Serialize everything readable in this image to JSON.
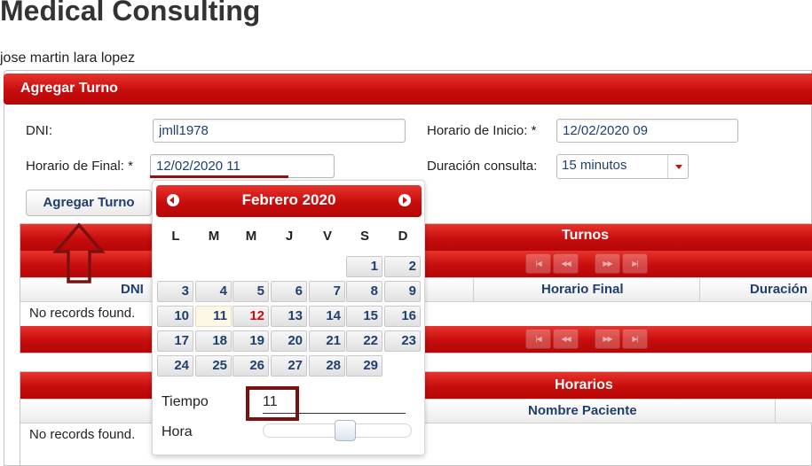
{
  "page": {
    "title": "Medical Consulting",
    "user": "jose martin lara lopez"
  },
  "panel": {
    "title": "Agregar Turno"
  },
  "form": {
    "dni": {
      "label": "DNI:",
      "value": "jmll1978"
    },
    "horario_inicio": {
      "label": "Horario de Inicio:",
      "required": "*",
      "value": "12/02/2020 09"
    },
    "horario_final": {
      "label": "Horario de Final:",
      "required": "*",
      "value": "12/02/2020 11"
    },
    "duracion": {
      "label": "Duración consulta:",
      "value": "15 minutos"
    },
    "submit_label": "Agregar Turno"
  },
  "turnos_table": {
    "title": "Turnos",
    "columns": [
      "DNI",
      "Horario Final",
      "Duración"
    ],
    "empty_message": "No records found."
  },
  "horarios_table": {
    "title": "Horarios",
    "columns": [
      "Nombre Paciente"
    ],
    "empty_message": "No records found."
  },
  "calendar": {
    "month_label": "Febrero 2020",
    "weekdays": [
      "L",
      "M",
      "M",
      "J",
      "V",
      "S",
      "D"
    ],
    "weeks": [
      [
        "",
        "",
        "",
        "",
        "",
        "1",
        "2"
      ],
      [
        "3",
        "4",
        "5",
        "6",
        "7",
        "8",
        "9"
      ],
      [
        "10",
        "11",
        "12",
        "13",
        "14",
        "15",
        "16"
      ],
      [
        "17",
        "18",
        "19",
        "20",
        "21",
        "22",
        "23"
      ],
      [
        "24",
        "25",
        "26",
        "27",
        "28",
        "29",
        ""
      ]
    ],
    "today": "11",
    "selected": "12",
    "time_label": "Tiempo",
    "time_value": "11",
    "hour_label": "Hora",
    "hour_value": 11,
    "hour_max": 23
  },
  "colors": {
    "accent": "#c70d0d",
    "link": "#1f3f6e",
    "annotation": "#7a1010"
  }
}
